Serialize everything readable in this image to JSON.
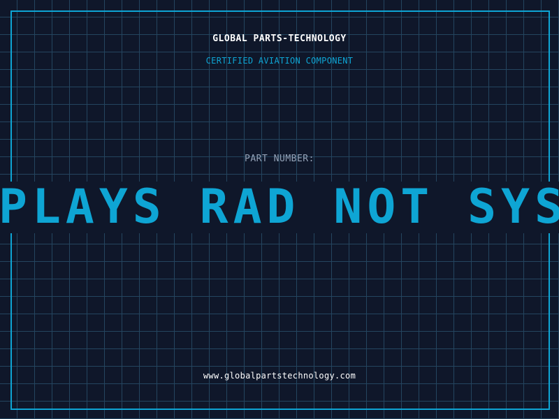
{
  "header": {
    "company": "GLOBAL PARTS-TECHNOLOGY",
    "subtitle": "CERTIFIED AVIATION COMPONENT"
  },
  "part": {
    "label": "PART NUMBER:",
    "value": "PLAYS RAD NOT SYST"
  },
  "footer": {
    "website": "www.globalpartstechnology.com"
  },
  "colors": {
    "background": "#0f172a",
    "grid": "#24455f",
    "accent": "#0ea5d4",
    "label": "#94a3b8",
    "text": "#ffffff"
  }
}
